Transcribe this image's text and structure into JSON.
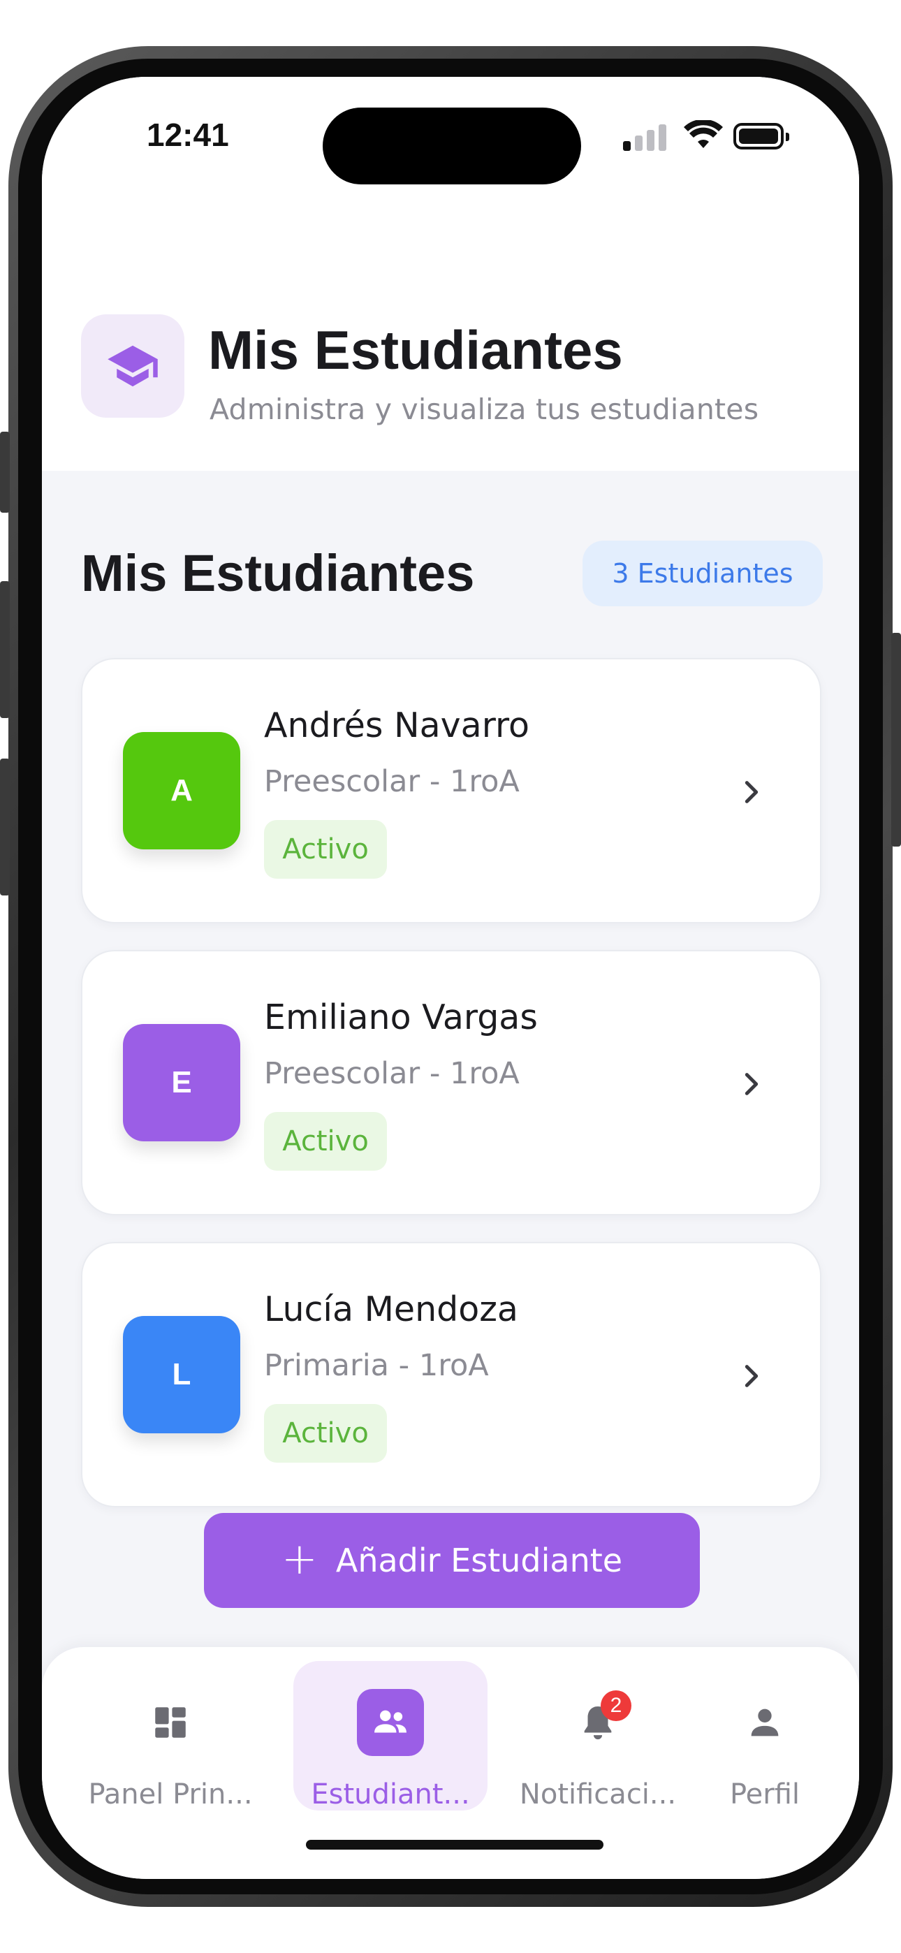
{
  "status_bar": {
    "time": "12:41"
  },
  "header": {
    "icon": "graduation-cap-icon",
    "title": "Mis Estudiantes",
    "subtitle": "Administra y visualiza tus estudiantes"
  },
  "section": {
    "title": "Mis Estudiantes",
    "count_label": "3 Estudiantes"
  },
  "students": [
    {
      "initial": "A",
      "name": "Andrés Navarro",
      "level": "Preescolar - 1roA",
      "status": "Activo",
      "color": "#55c80e"
    },
    {
      "initial": "E",
      "name": "Emiliano Vargas",
      "level": "Preescolar - 1roA",
      "status": "Activo",
      "color": "#9b5ee6"
    },
    {
      "initial": "L",
      "name": "Lucía Mendoza",
      "level": "Primaria - 1roA",
      "status": "Activo",
      "color": "#3a86f6"
    }
  ],
  "add_button": {
    "icon": "+",
    "label": "Añadir Estudiante"
  },
  "bottom_nav": {
    "items": [
      {
        "label": "Panel Prin...",
        "icon": "dashboard-icon"
      },
      {
        "label": "Estudiant...",
        "icon": "people-icon",
        "active": true
      },
      {
        "label": "Notificaci...",
        "icon": "bell-icon",
        "badge": "2"
      },
      {
        "label": "Perfil",
        "icon": "person-icon"
      }
    ]
  },
  "colors": {
    "accent": "#9b5ee6",
    "status_green": "#5bb43c",
    "badge_blue": "#3d7ae9",
    "notification_red": "#ee3a3a"
  }
}
